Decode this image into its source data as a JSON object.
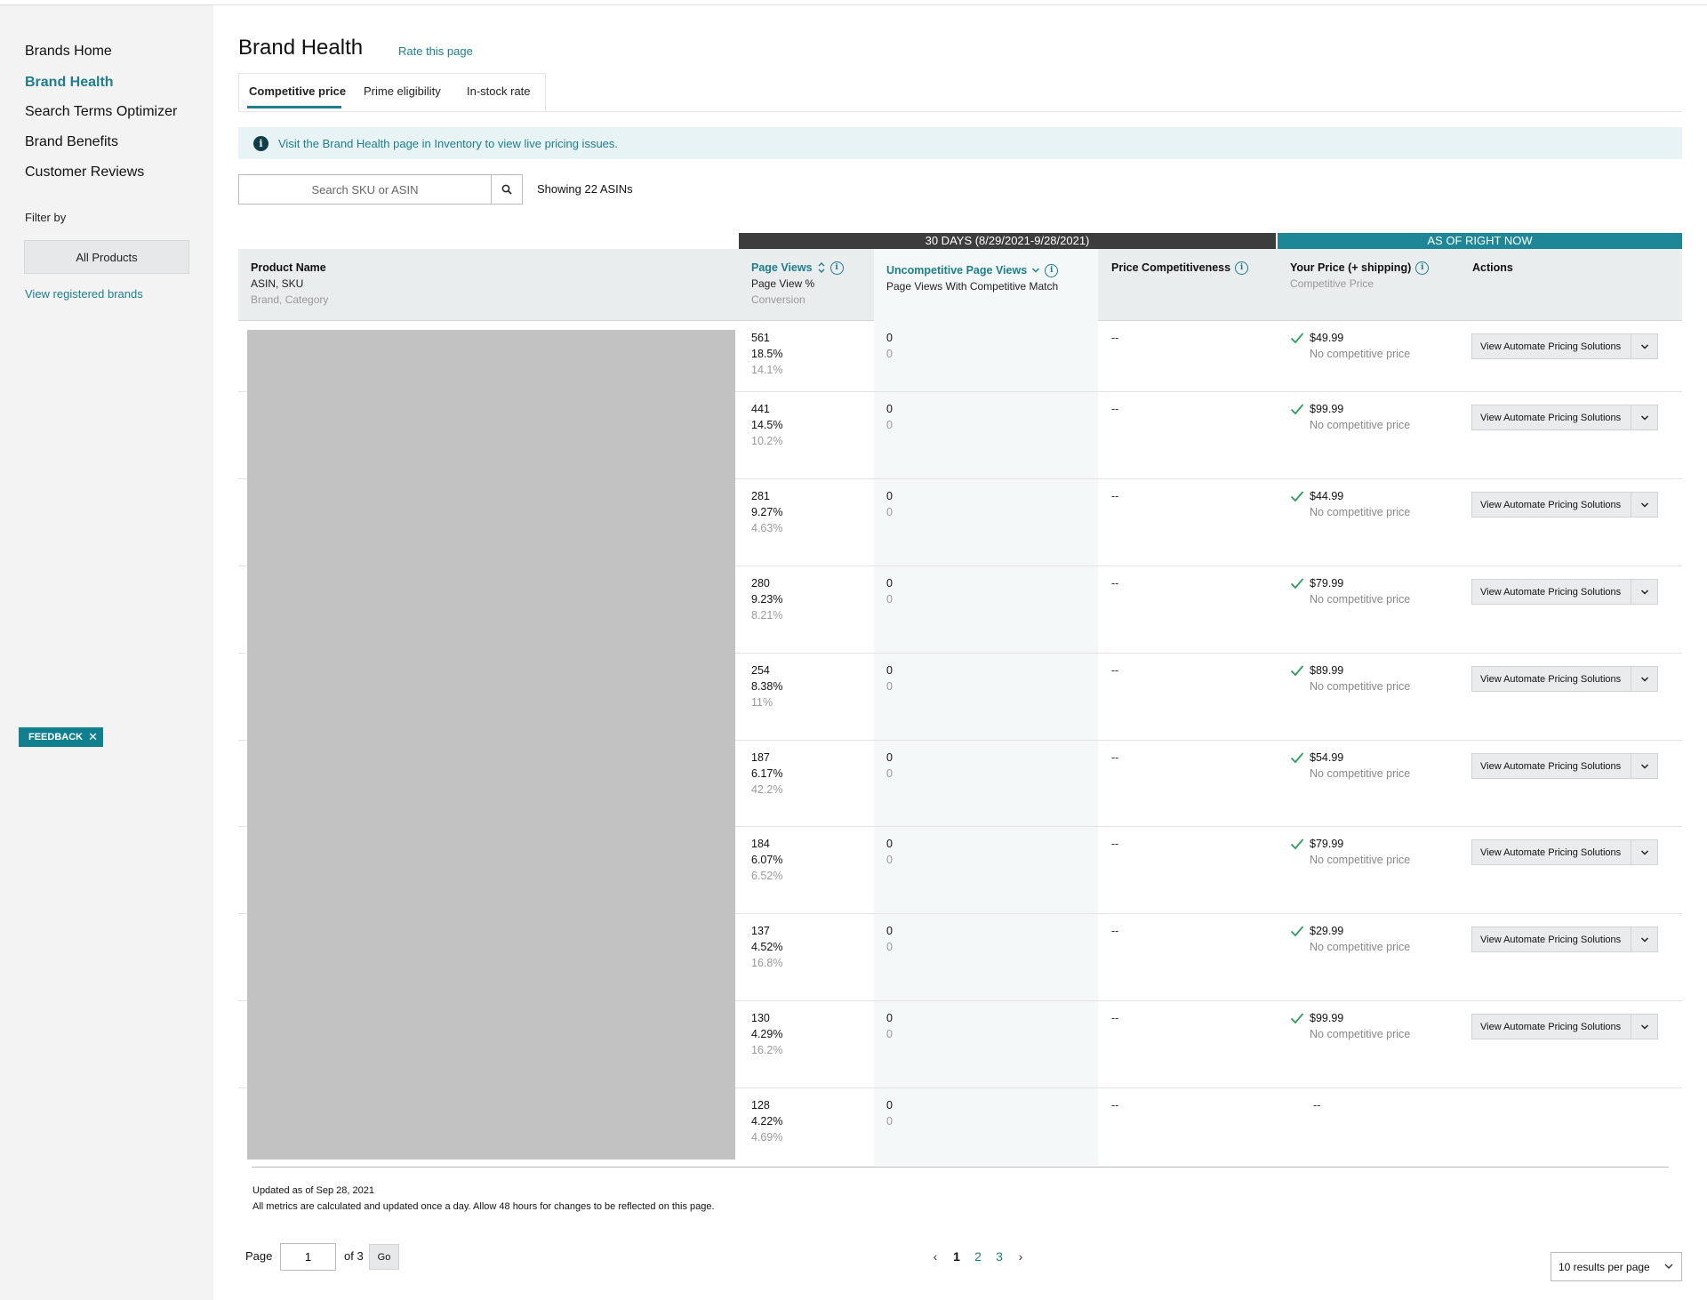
{
  "sidebar": {
    "items": [
      {
        "label": "Brands Home",
        "active": false
      },
      {
        "label": "Brand Health",
        "active": true
      },
      {
        "label": "Search Terms Optimizer",
        "active": false
      },
      {
        "label": "Brand Benefits",
        "active": false
      },
      {
        "label": "Customer Reviews",
        "active": false
      }
    ],
    "filter_label": "Filter by",
    "filter_button": "All Products",
    "view_registered": "View registered brands",
    "feedback": "FEEDBACK"
  },
  "header": {
    "title": "Brand Health",
    "rate_link": "Rate this page"
  },
  "tabs": [
    {
      "label": "Competitive price",
      "active": true
    },
    {
      "label": "Prime eligibility",
      "active": false
    },
    {
      "label": "In-stock rate",
      "active": false
    }
  ],
  "alert": {
    "text": "Visit the Brand Health page in Inventory to view live pricing issues."
  },
  "search": {
    "placeholder": "Search SKU or ASIN",
    "showing": "Showing 22 ASINs"
  },
  "bands": {
    "period": "30 DAYS (8/29/2021-9/28/2021)",
    "now": "AS OF RIGHT NOW"
  },
  "columns": {
    "product": {
      "title": "Product Name",
      "sub1": "ASIN, SKU",
      "sub2": "Brand, Category"
    },
    "page_views": {
      "title": "Page Views",
      "sub1": "Page View %",
      "sub2": "Conversion"
    },
    "uncompetitive": {
      "title": "Uncompetitive Page Views",
      "sub1": "Page Views With Competitive Match"
    },
    "price_comp": {
      "title": "Price Competitiveness"
    },
    "your_price": {
      "title": "Your Price (+ shipping)",
      "sub1": "Competitive Price"
    },
    "actions": {
      "title": "Actions"
    }
  },
  "rows": [
    {
      "views": "561",
      "pct": "18.5%",
      "conv": "14.1%",
      "uncomp": "0",
      "match": "0",
      "comp": "--",
      "price": "$49.99",
      "price_sub": "No competitive price",
      "action": "View Automate Pricing Solutions"
    },
    {
      "views": "441",
      "pct": "14.5%",
      "conv": "10.2%",
      "uncomp": "0",
      "match": "0",
      "comp": "--",
      "price": "$99.99",
      "price_sub": "No competitive price",
      "action": "View Automate Pricing Solutions"
    },
    {
      "views": "281",
      "pct": "9.27%",
      "conv": "4.63%",
      "uncomp": "0",
      "match": "0",
      "comp": "--",
      "price": "$44.99",
      "price_sub": "No competitive price",
      "action": "View Automate Pricing Solutions"
    },
    {
      "views": "280",
      "pct": "9.23%",
      "conv": "8.21%",
      "uncomp": "0",
      "match": "0",
      "comp": "--",
      "price": "$79.99",
      "price_sub": "No competitive price",
      "action": "View Automate Pricing Solutions"
    },
    {
      "views": "254",
      "pct": "8.38%",
      "conv": "11%",
      "uncomp": "0",
      "match": "0",
      "comp": "--",
      "price": "$89.99",
      "price_sub": "No competitive price",
      "action": "View Automate Pricing Solutions"
    },
    {
      "views": "187",
      "pct": "6.17%",
      "conv": "42.2%",
      "uncomp": "0",
      "match": "0",
      "comp": "--",
      "price": "$54.99",
      "price_sub": "No competitive price",
      "action": "View Automate Pricing Solutions"
    },
    {
      "views": "184",
      "pct": "6.07%",
      "conv": "6.52%",
      "uncomp": "0",
      "match": "0",
      "comp": "--",
      "price": "$79.99",
      "price_sub": "No competitive price",
      "action": "View Automate Pricing Solutions"
    },
    {
      "views": "137",
      "pct": "4.52%",
      "conv": "16.8%",
      "uncomp": "0",
      "match": "0",
      "comp": "--",
      "price": "$29.99",
      "price_sub": "No competitive price",
      "action": "View Automate Pricing Solutions"
    },
    {
      "views": "130",
      "pct": "4.29%",
      "conv": "16.2%",
      "uncomp": "0",
      "match": "0",
      "comp": "--",
      "price": "$99.99",
      "price_sub": "No competitive price",
      "action": "View Automate Pricing Solutions"
    },
    {
      "views": "128",
      "pct": "4.22%",
      "conv": "4.69%",
      "uncomp": "0",
      "match": "0",
      "comp": "--",
      "price": "--",
      "price_sub": "",
      "action": ""
    }
  ],
  "footer": {
    "updated": "Updated as of Sep 28, 2021",
    "note": "All metrics are calculated and updated once a day. Allow 48 hours for changes to be reflected on this page."
  },
  "pagination": {
    "page_label": "Page",
    "page_value": "1",
    "of_label": "of 3",
    "go": "Go",
    "pages": [
      "1",
      "2",
      "3"
    ],
    "current": "1",
    "per_page": "10 results per page"
  },
  "colors": {
    "accent": "#1e7e8c",
    "band_dark": "#3d3d3d",
    "band_teal": "#1e8797",
    "check": "#2e9e5b"
  },
  "icons": {
    "search": "search-icon",
    "info": "info-icon",
    "check": "check-icon",
    "chevron": "chevron-down-icon",
    "sort": "sort-icon",
    "close": "close-icon"
  }
}
